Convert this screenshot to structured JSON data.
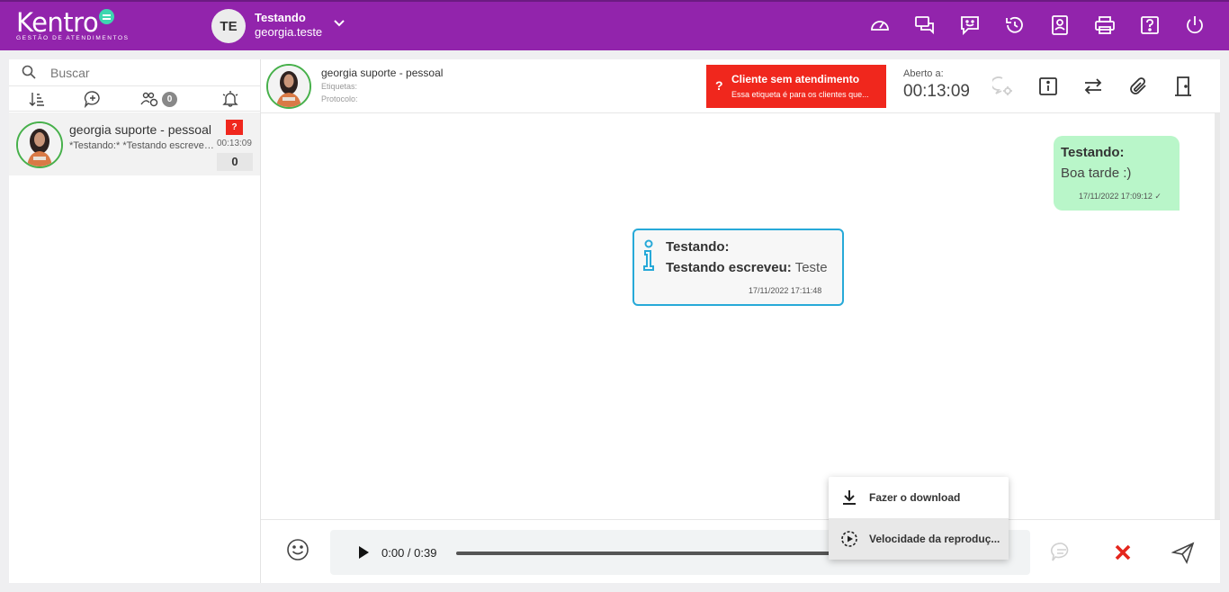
{
  "brand": {
    "name": "Kentro",
    "subtitle": "GESTÃO DE ATENDIMENTOS"
  },
  "user": {
    "initials": "TE",
    "name": "Testando",
    "login": "georgia.teste"
  },
  "topbar_icons": [
    "speedometer-icon",
    "chats-icon",
    "feedback-icon",
    "history-icon",
    "contacts-icon",
    "print-icon",
    "help-icon",
    "power-icon"
  ],
  "sidebar": {
    "search_placeholder": "Buscar",
    "group_badge": "0",
    "contacts": [
      {
        "name": "georgia suporte - pessoal",
        "preview": "*Testando:* *Testando escreveu: Teste",
        "flag": "?",
        "time": "00:13:09",
        "unread": "0"
      }
    ]
  },
  "chat": {
    "contact_name": "georgia suporte - pessoal",
    "tags_label": "Etiquetas:",
    "protocol_label": "Protocolo:",
    "alert": {
      "icon": "?",
      "title": "Cliente sem atendimento",
      "subtitle": "Essa etiqueta é para os clientes que..."
    },
    "opened_label": "Aberto a:",
    "opened_time": "00:13:09",
    "messages": {
      "outgoing": {
        "author": "Testando:",
        "text": "Boa tarde :)",
        "time": "17/11/2022 17:09:12 ✓"
      },
      "system": {
        "author": "Testando:",
        "line_label": "Testando escreveu:",
        "line_value": "Teste",
        "time": "17/11/2022 17:11:48"
      }
    },
    "audio": {
      "time": "0:00 / 0:39",
      "progress": 0.0
    }
  },
  "context_menu": {
    "download": "Fazer o download",
    "speed": "Velocidade da reproduç..."
  },
  "colors": {
    "topbar": "#9224ac",
    "accent_green": "#46b04a",
    "alert_red": "#f0271d",
    "outgoing_bubble": "#b9f6c9",
    "system_border": "#27a9d8"
  }
}
